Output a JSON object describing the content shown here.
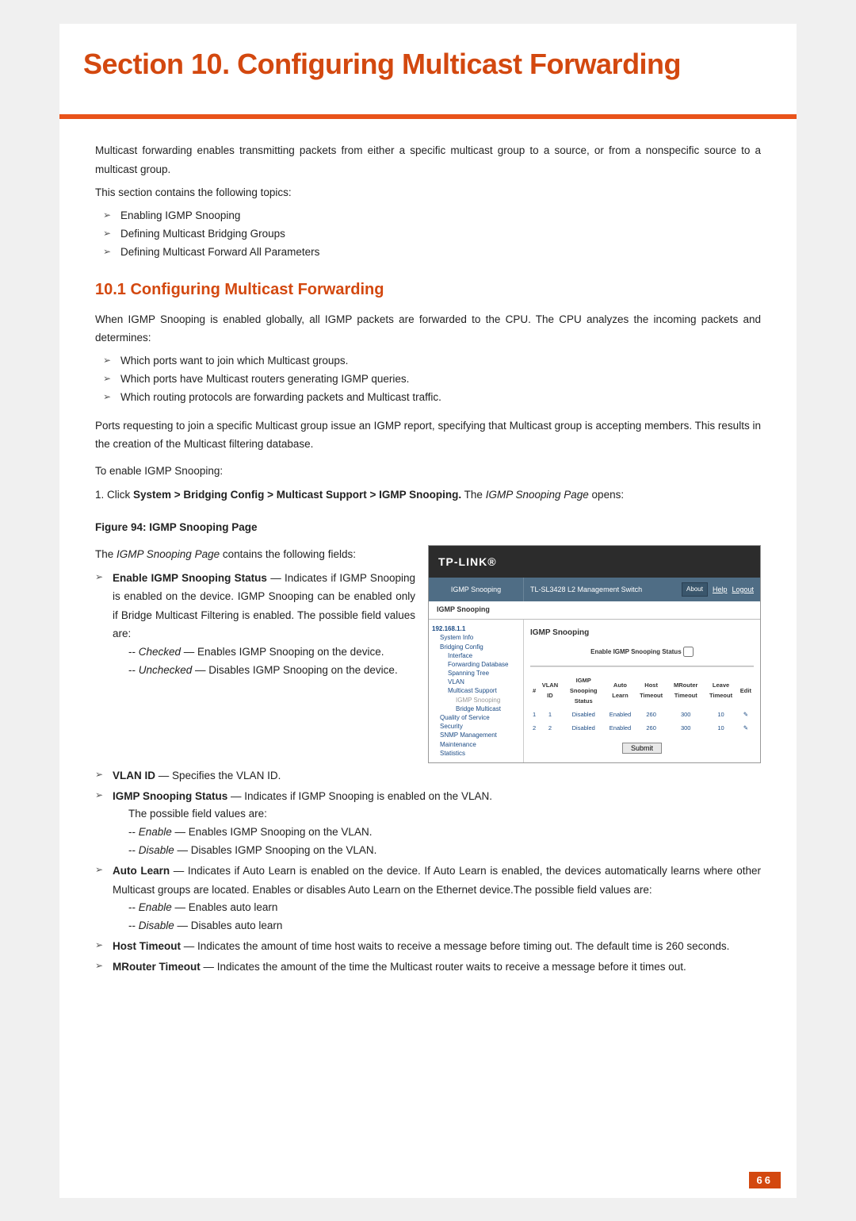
{
  "title": "Section 10.  Configuring Multicast Forwarding",
  "intro1": "Multicast forwarding enables transmitting packets from either a specific multicast group to a source, or from a nonspecific source to a multicast group.",
  "intro2": "This section contains the following topics:",
  "topics": [
    "Enabling IGMP Snooping",
    "Defining Multicast Bridging Groups",
    "Defining Multicast Forward All Parameters"
  ],
  "h2": "10.1   Configuring Multicast Forwarding",
  "p101a": "When IGMP Snooping is enabled globally, all IGMP packets are forwarded to the CPU. The CPU analyzes the incoming packets and determines:",
  "determines": [
    "Which ports want to join which Multicast groups.",
    "Which ports have Multicast routers generating IGMP queries.",
    "Which routing protocols are forwarding packets and Multicast traffic."
  ],
  "p101b": "Ports requesting to join a specific Multicast group issue an IGMP report, specifying that Multicast group is accepting members. This results in the creation of the Multicast filtering database.",
  "p101c": "To enable IGMP Snooping:",
  "step1_prefix": "1.   Click ",
  "step1_bold": "System > Bridging Config > Multicast Support > IGMP Snooping.",
  "step1_mid": " The ",
  "step1_italic": "IGMP Snooping Page",
  "step1_suffix": " opens:",
  "figcap": "Figure 94: IGMP Snooping Page",
  "introFields_prefix": "The ",
  "introFields_italic": "IGMP Snooping Page",
  "introFields_suffix": " contains the following fields:",
  "field1": {
    "name": "Enable IGMP Snooping Status",
    "desc": " — Indicates if IGMP Snooping is enabled on the device. IGMP Snooping can be enabled only if Bridge Multicast Filtering is enabled. The possible field values are:",
    "v1label": "Checked",
    "v1desc": " — Enables IGMP Snooping on the device.",
    "v2label": "Unchecked",
    "v2desc": " — Disables IGMP Snooping on the device."
  },
  "field2": {
    "name": "VLAN ID",
    "desc": " — Specifies the VLAN ID."
  },
  "field3": {
    "name": "IGMP Snooping Status",
    "desc": " — Indicates if IGMP Snooping is enabled on the VLAN.",
    "sub0": "The possible field values are:",
    "v1label": "Enable",
    "v1desc": " — Enables IGMP Snooping on the VLAN.",
    "v2label": "Disable",
    "v2desc": " — Disables IGMP Snooping on the VLAN."
  },
  "field4": {
    "name": "Auto Learn",
    "desc": " — Indicates if Auto Learn is enabled on the device. If Auto Learn is enabled, the devices automatically learns where other Multicast groups are located. Enables or disables Auto Learn on the Ethernet device.The possible field values are:",
    "v1label": "Enable",
    "v1desc": " — Enables auto learn",
    "v2label": "Disable",
    "v2desc": " — Disables auto learn"
  },
  "field5": {
    "name": "Host Timeout",
    "desc": " — Indicates the amount of time host waits to receive a message before timing out. The default time is 260 seconds."
  },
  "field6": {
    "name": "MRouter Timeout",
    "desc": " — Indicates the amount of the time the Multicast router waits to receive a message before it times out."
  },
  "pageNumber": "66",
  "screenshot": {
    "brand": "TP-LINK®",
    "headerLeft": "IGMP Snooping",
    "headerTitle": "TL-SL3428 L2 Management Switch",
    "about": "About",
    "help": "Help",
    "logout": "Logout",
    "tab": "IGMP Snooping",
    "mainTitle": "IGMP Snooping",
    "enableLabel": "Enable IGMP Snooping Status",
    "submit": "Submit",
    "tree": {
      "ip": "192.168.1.1",
      "n1": "System Info",
      "n2": "Bridging Config",
      "n2a": "Interface",
      "n2b": "Forwarding Database",
      "n2c": "Spanning Tree",
      "n2d": "VLAN",
      "n2e": "Multicast Support",
      "n2e1": "IGMP Snooping",
      "n2e2": "Bridge Multicast",
      "n3": "Quality of Service",
      "n4": "Security",
      "n5": "SNMP Management",
      "n6": "Maintenance",
      "n7": "Statistics"
    },
    "table": {
      "h1": "#",
      "h2": "VLAN ID",
      "h3": "IGMP Snooping Status",
      "h4": "Auto Learn",
      "h5": "Host Timeout",
      "h6": "MRouter Timeout",
      "h7": "Leave Timeout",
      "h8": "Edit",
      "rows": [
        {
          "num": "1",
          "vlan": "1",
          "status": "Disabled",
          "auto": "Enabled",
          "host": "260",
          "mr": "300",
          "leave": "10"
        },
        {
          "num": "2",
          "vlan": "2",
          "status": "Disabled",
          "auto": "Enabled",
          "host": "260",
          "mr": "300",
          "leave": "10"
        }
      ]
    }
  }
}
